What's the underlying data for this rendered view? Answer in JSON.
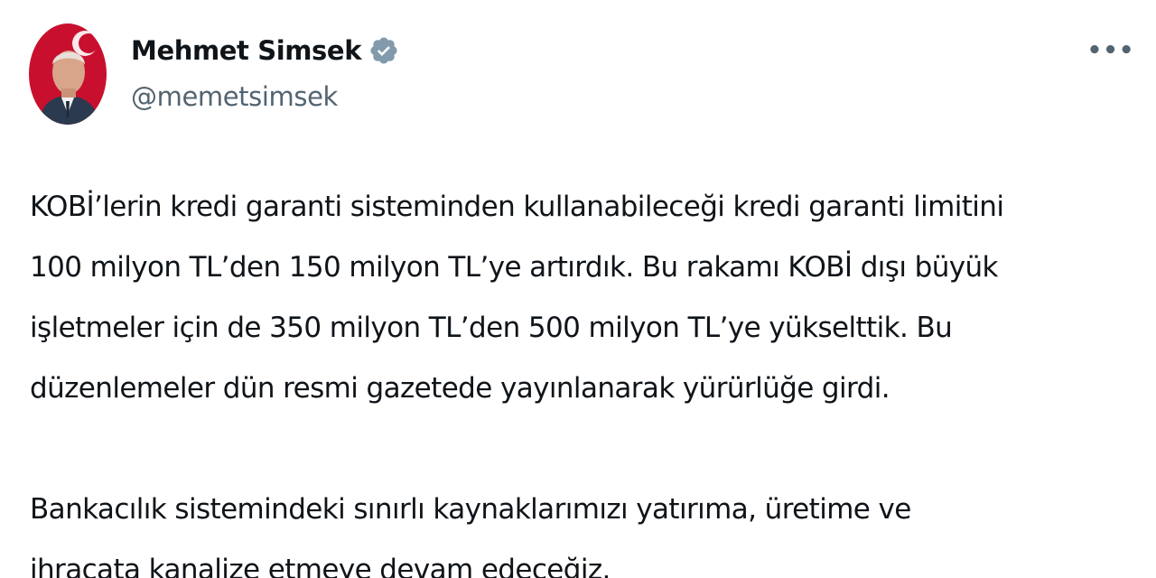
{
  "author": {
    "display_name": "Mehmet Simsek",
    "handle": "@memetsimsek",
    "verified": true,
    "verified_color": "#829aab"
  },
  "icons": {
    "avatar": "profile-photo",
    "verified": "verified-badge-icon",
    "more": "more-options-icon"
  },
  "colors": {
    "text_primary": "#0f1419",
    "text_secondary": "#536471"
  },
  "tweet": {
    "paragraphs": [
      "KOBİ’lerin kredi garanti sisteminden kullanabileceği kredi garanti limitini\n100 milyon TL’den 150 milyon TL’ye artırdık.  Bu rakamı KOBİ dışı büyük\nişletmeler için de 350 milyon TL’den 500 milyon TL’ye yükselttik. Bu\ndüzenlemeler dün resmi gazetede yayınlanarak yürürlüğe girdi.",
      "Bankacılık sistemindeki sınırlı kaynaklarımızı yatırıma, üretime ve\nihracata kanalize etmeye devam edeceğiz."
    ]
  }
}
